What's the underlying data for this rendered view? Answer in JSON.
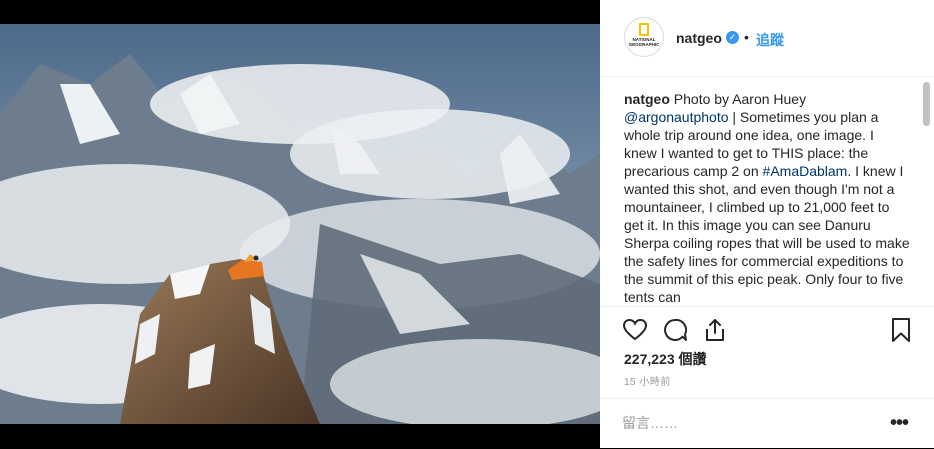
{
  "post": {
    "username": "natgeo",
    "verified_icon": "verified-badge-icon",
    "separator": "•",
    "follow_label": "追蹤",
    "avatar_text": "NATIONAL GEOGRAPHIC",
    "caption": {
      "user": "natgeo",
      "segments": [
        {
          "text": " Photo by Aaron Huey ",
          "link": false
        },
        {
          "text": "@argonautphoto",
          "link": true
        },
        {
          "text": " | Sometimes you plan a whole trip around one idea, one image. I knew I wanted to get to THIS place: the precarious camp 2 on ",
          "link": false
        },
        {
          "text": "#AmaDablam",
          "link": true
        },
        {
          "text": ". I knew I wanted this shot, and even though I'm not a mountaineer, I climbed up to 21,000 feet to get it. In this image you can see Danuru Sherpa coiling ropes that will be used to make the safety lines for commercial expeditions to the summit of this epic peak. Only four to five tents can",
          "link": false
        }
      ]
    },
    "likes": "227,223 個讚",
    "time_ago": "15 小時前",
    "comment_placeholder": "留言……",
    "more_label": "•••",
    "icons": [
      "heart-icon",
      "comment-icon",
      "share-icon",
      "bookmark-icon"
    ],
    "colors": {
      "link": "#3897f0",
      "text": "#262626",
      "muted": "#999999"
    }
  }
}
